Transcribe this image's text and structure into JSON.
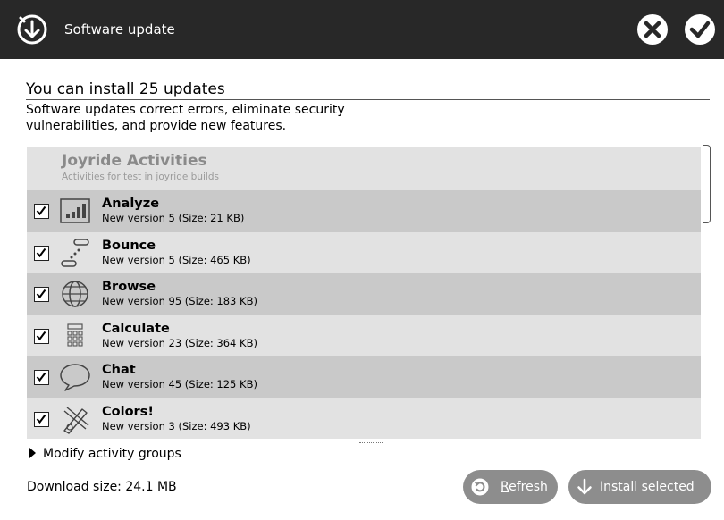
{
  "window": {
    "title": "Software update",
    "icon": "software-update-icon"
  },
  "header_buttons": {
    "cancel_icon": "close-icon",
    "ok_icon": "checkmark-icon"
  },
  "summary": {
    "heading": "You can install 25 updates",
    "description": "Software updates correct errors, eliminate security vulnerabilities, and provide new features."
  },
  "group": {
    "title": "Joyride Activities",
    "subtitle": "Activities for test in joyride builds"
  },
  "updates": [
    {
      "name": "Analyze",
      "version": "New version 5 (Size: 21 KB)",
      "checked": true,
      "icon": "analyze-icon"
    },
    {
      "name": "Bounce",
      "version": "New version 5 (Size: 465 KB)",
      "checked": true,
      "icon": "bounce-icon"
    },
    {
      "name": "Browse",
      "version": "New version 95 (Size: 183 KB)",
      "checked": true,
      "icon": "browse-icon"
    },
    {
      "name": "Calculate",
      "version": "New version 23 (Size: 364 KB)",
      "checked": true,
      "icon": "calculate-icon"
    },
    {
      "name": "Chat",
      "version": "New version 45 (Size: 125 KB)",
      "checked": true,
      "icon": "chat-icon"
    },
    {
      "name": "Colors!",
      "version": "New version 3 (Size: 493 KB)",
      "checked": true,
      "icon": "colors-icon"
    }
  ],
  "footer": {
    "modify_groups": "Modify activity groups",
    "download_size": "Download size: 24.1 MB",
    "refresh_label": "Refresh",
    "install_label": "Install selected"
  },
  "colors": {
    "titlebar": "#282828",
    "row_odd": "#c9c9c9",
    "row_even": "#e2e2e2",
    "button": "#8d8d8d"
  }
}
